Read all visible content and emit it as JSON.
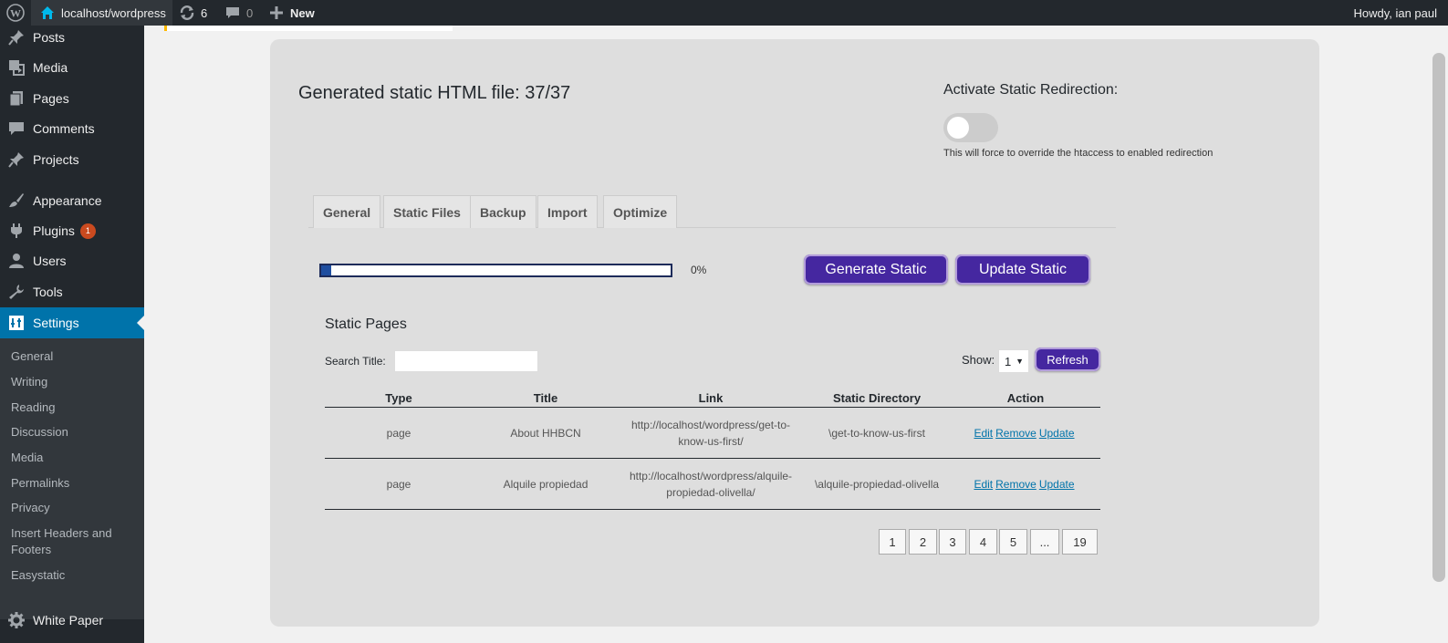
{
  "adminbar": {
    "site": "localhost/wordpress",
    "updates_count": "6",
    "comments_count": "0",
    "new_label": "New",
    "howdy": "Howdy, ian paul"
  },
  "sidebar": {
    "items": [
      {
        "label": "Posts",
        "icon": "pin-icon"
      },
      {
        "label": "Media",
        "icon": "media-icon"
      },
      {
        "label": "Pages",
        "icon": "pages-icon"
      },
      {
        "label": "Comments",
        "icon": "comment-icon"
      },
      {
        "label": "Projects",
        "icon": "pin-icon"
      },
      {
        "label": "Appearance",
        "icon": "brush-icon"
      },
      {
        "label": "Plugins",
        "icon": "plugin-icon",
        "badge": "1"
      },
      {
        "label": "Users",
        "icon": "user-icon"
      },
      {
        "label": "Tools",
        "icon": "wrench-icon"
      },
      {
        "label": "Settings",
        "icon": "settings-icon"
      },
      {
        "label": "White Paper",
        "icon": "gear-icon"
      }
    ],
    "submenu": [
      "General",
      "Writing",
      "Reading",
      "Discussion",
      "Media",
      "Permalinks",
      "Privacy",
      "Insert Headers and Footers",
      "Easystatic"
    ]
  },
  "main": {
    "generated_title": "Generated static HTML file: 37/37",
    "redirect_title": "Activate Static Redirection:",
    "redirect_help": "This will force to override the htaccess to enabled redirection",
    "tabs": [
      "General",
      "Static Files",
      "Backup",
      "Import",
      "Optimize"
    ],
    "progress_percent": 0,
    "progress_text": "0%",
    "generate_label": "Generate Static",
    "update_label": "Update Static",
    "static_pages_title": "Static Pages",
    "search_label": "Search Title:",
    "show_label": "Show:",
    "show_value": "1",
    "refresh_label": "Refresh",
    "columns": [
      "Type",
      "Title",
      "Link",
      "Static Directory",
      "Action"
    ],
    "rows": [
      {
        "type": "page",
        "title": "About HHBCN",
        "link_line1": "http://localhost/wordpress/get-to-",
        "link_line2": "know-us-first/",
        "dir": "\\get-to-know-us-first"
      },
      {
        "type": "page",
        "title": "Alquile propiedad",
        "link_line1": "http://localhost/wordpress/alquile-",
        "link_line2": "propiedad-olivella/",
        "dir": "\\alquile-propiedad-olivella"
      }
    ],
    "actions": [
      "Edit",
      "Remove",
      "Update"
    ],
    "pagination": [
      "1",
      "2",
      "3",
      "4",
      "5",
      "...",
      "19"
    ]
  },
  "colors": {
    "accent": "#0073aa",
    "button_purple": "#4527a0",
    "admin_dark": "#23282d"
  }
}
